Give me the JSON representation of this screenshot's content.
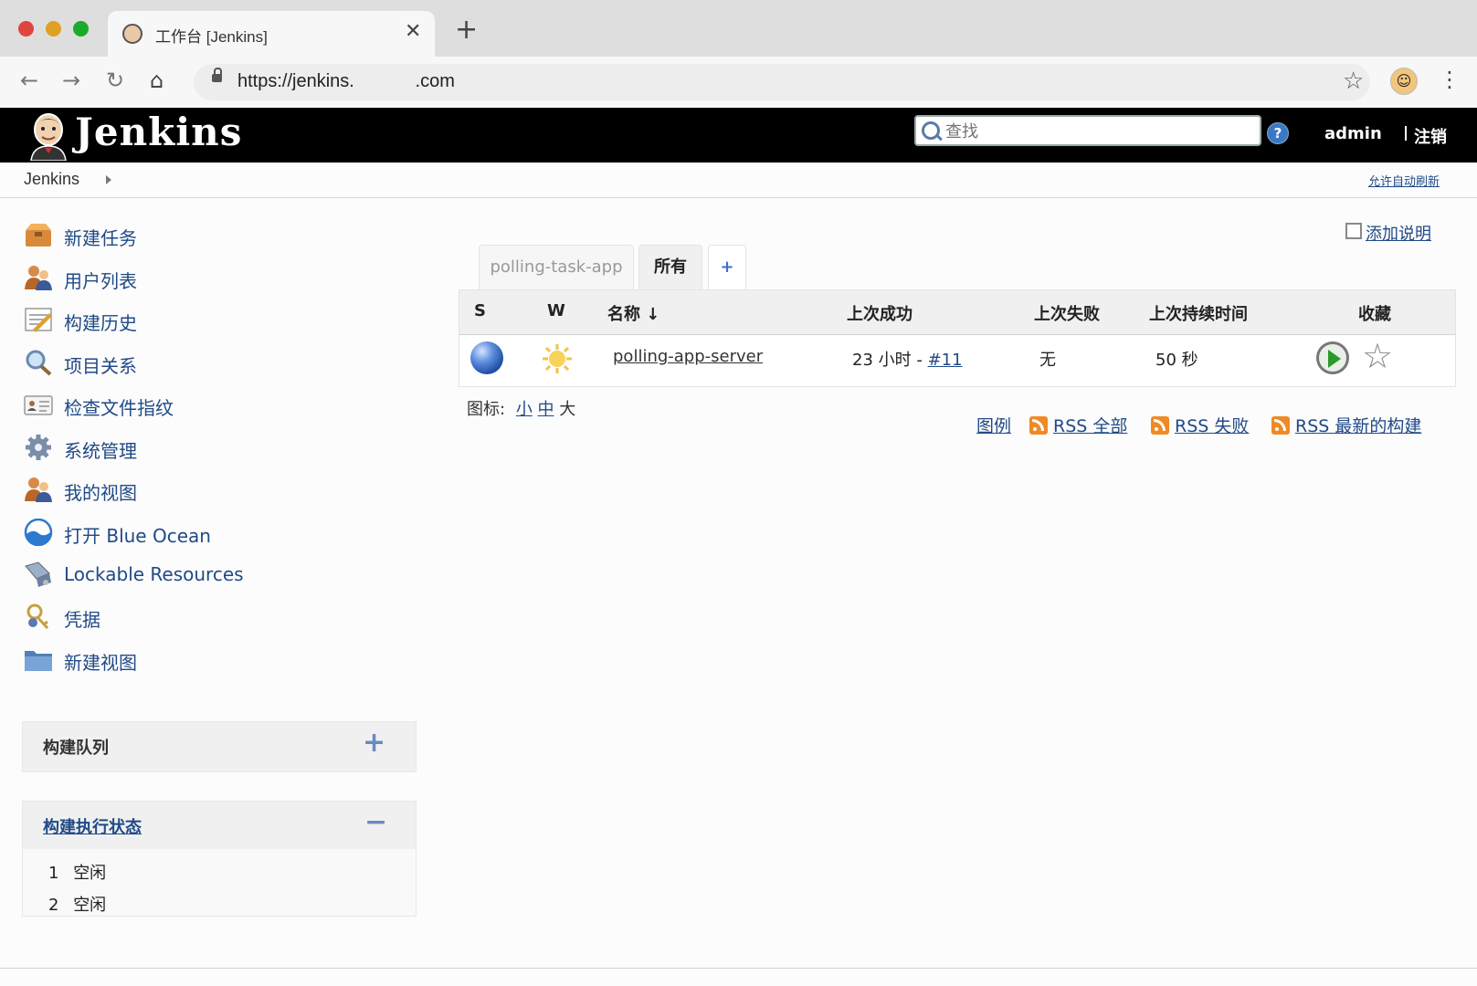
{
  "browser": {
    "tab_title": "工作台 [Jenkins]",
    "url": "https://jenkins.            .com",
    "traffic_lights": [
      "#e0443e",
      "#dea123",
      "#1aab29"
    ]
  },
  "header": {
    "logo_text": "Jenkins",
    "search_placeholder": "查找",
    "help_label": "?",
    "user": "admin",
    "logout": "注销"
  },
  "breadcrumb": {
    "root": "Jenkins",
    "auto_refresh": "允许自动刷新"
  },
  "sidebar": {
    "tasks": [
      {
        "label": "新建任务",
        "icon": "new-item-icon"
      },
      {
        "label": "用户列表",
        "icon": "users-icon"
      },
      {
        "label": "构建历史",
        "icon": "build-history-icon"
      },
      {
        "label": "项目关系",
        "icon": "search-icon"
      },
      {
        "label": "检查文件指纹",
        "icon": "fingerprint-icon"
      },
      {
        "label": "系统管理",
        "icon": "gear-icon"
      },
      {
        "label": "我的视图",
        "icon": "my-views-icon"
      },
      {
        "label": "打开 Blue Ocean",
        "icon": "blue-ocean-icon"
      },
      {
        "label": "Lockable Resources",
        "icon": "lockable-resources-icon"
      },
      {
        "label": "凭据",
        "icon": "credentials-icon"
      },
      {
        "label": "新建视图",
        "icon": "folder-icon"
      }
    ],
    "build_queue": {
      "title": "构建队列",
      "toggle": "+"
    },
    "executors": {
      "title": "构建执行状态",
      "toggle": "−",
      "rows": [
        {
          "num": "1",
          "status": "空闲"
        },
        {
          "num": "2",
          "status": "空闲"
        }
      ]
    }
  },
  "main": {
    "add_description": "添加说明",
    "view_tabs": [
      {
        "label": "polling-task-app",
        "active": false
      },
      {
        "label": "所有",
        "active": true
      },
      {
        "label": "+",
        "active": false
      }
    ],
    "table": {
      "headers": [
        "S",
        "W",
        "名称 ↓",
        "上次成功",
        "上次失败",
        "上次持续时间",
        "收藏"
      ],
      "rows": [
        {
          "name": "polling-app-server",
          "last_success_prefix": "23 小时 - ",
          "last_success_build": "#11",
          "last_failure": "无",
          "last_duration": "50 秒",
          "status_color": "#3a6fd0",
          "weather_icon": "sun-icon"
        }
      ]
    },
    "icon_size": {
      "label": "图标:",
      "small": "小",
      "medium": "中",
      "large": "大"
    },
    "links": {
      "legend": "图例",
      "rss_all": "RSS 全部",
      "rss_failed": "RSS 失败",
      "rss_latest": "RSS 最新的构建"
    }
  }
}
